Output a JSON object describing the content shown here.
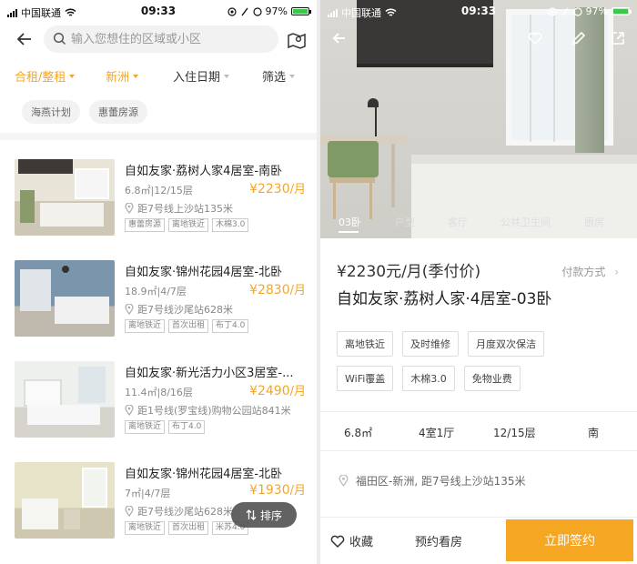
{
  "left": {
    "status": {
      "carrier": "中国联通",
      "time": "09:33",
      "battery": "97%",
      "battery_level": 0.97
    },
    "search": {
      "placeholder": "输入您想住的区域或小区"
    },
    "filters": [
      {
        "label": "合租/整租",
        "active": true
      },
      {
        "label": "新洲",
        "active": true
      },
      {
        "label": "入住日期",
        "active": false
      },
      {
        "label": "筛选",
        "active": false
      }
    ],
    "tags": [
      "海燕计划",
      "惠蕾房源"
    ],
    "listings": [
      {
        "title": "自如友家·荔树人家4居室-南卧",
        "meta": "6.8㎡|12/15层",
        "price": "¥2230",
        "unit": "/月",
        "location": "距7号线上沙站135米",
        "badges": [
          "惠蕾房源",
          "离地铁近",
          "木棉3.0"
        ]
      },
      {
        "title": "自如友家·锦州花园4居室-北卧",
        "meta": "18.9㎡|4/7层",
        "price": "¥2830",
        "unit": "/月",
        "location": "距7号线沙尾站628米",
        "badges": [
          "离地铁近",
          "首次出租",
          "布丁4.0"
        ]
      },
      {
        "title": "自如友家·新光活力小区3居室-...",
        "meta": "11.4㎡|8/16层",
        "price": "¥2490",
        "unit": "/月",
        "location": "距1号线(罗宝线)购物公园站841米",
        "badges": [
          "离地铁近",
          "布丁4.0"
        ]
      },
      {
        "title": "自如友家·锦州花园4居室-北卧",
        "meta": "7㎡|4/7层",
        "price": "¥1930",
        "unit": "/月",
        "location": "距7号线沙尾站628米",
        "badges": [
          "离地铁近",
          "首次出租",
          "米苏4.0"
        ]
      }
    ],
    "sort_label": "排序"
  },
  "right": {
    "status": {
      "carrier": "中国联通",
      "time": "09:33",
      "battery": "97%",
      "battery_level": 0.97
    },
    "hero_tabs": [
      {
        "label": "03卧",
        "active": true
      },
      {
        "label": "户型",
        "active": false
      },
      {
        "label": "客厅",
        "active": false
      },
      {
        "label": "公共卫生间",
        "active": false
      },
      {
        "label": "厨房",
        "active": false
      }
    ],
    "price": "¥2230元/月(季付价)",
    "payment_label": "付款方式",
    "title": "自如友家·荔树人家·4居室-03卧",
    "feature_tags_row1": [
      "离地铁近",
      "及时维修",
      "月度双次保洁"
    ],
    "feature_tags_row2": [
      "WiFi覆盖",
      "木棉3.0",
      "免物业费"
    ],
    "specs": [
      "6.8㎡",
      "4室1厅",
      "12/15层",
      "南"
    ],
    "address": "福田区-新洲, 距7号线上沙站135米",
    "actions": {
      "favorite": "收藏",
      "book": "预约看房",
      "sign": "立即签约"
    }
  },
  "colors": {
    "accent": "#f5a623"
  }
}
